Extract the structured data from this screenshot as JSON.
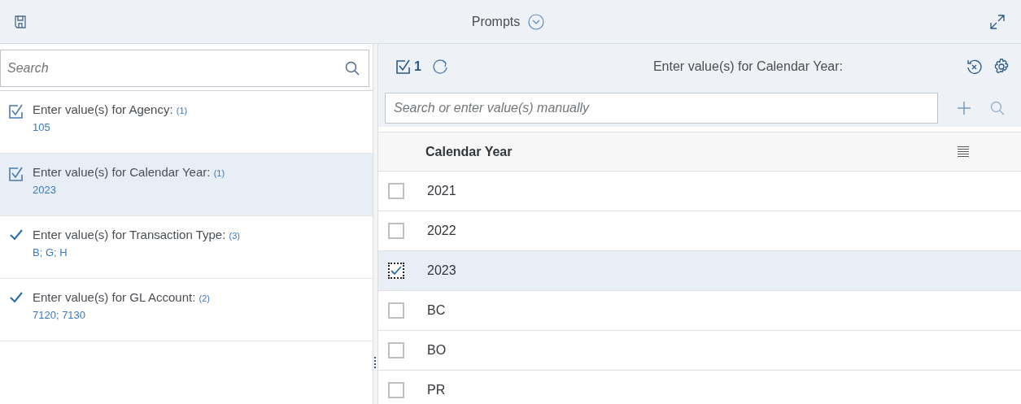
{
  "header": {
    "title": "Prompts"
  },
  "sidebar": {
    "search": {
      "placeholder": "Search"
    },
    "items": [
      {
        "kind": "box-check",
        "label": "Enter value(s) for Agency:",
        "count": "(1)",
        "values": "105",
        "selected": false
      },
      {
        "kind": "box-check",
        "label": "Enter value(s) for Calendar Year:",
        "count": "(1)",
        "values": "2023",
        "selected": true
      },
      {
        "kind": "check",
        "label": "Enter value(s) for Transaction Type:",
        "count": "(3)",
        "values": "B; G; H",
        "selected": false
      },
      {
        "kind": "check",
        "label": "Enter value(s) for GL Account:",
        "count": "(2)",
        "values": "7120; 7130",
        "selected": false
      }
    ]
  },
  "panel": {
    "selected_count": "1",
    "title": "Enter value(s) for Calendar Year:",
    "search": {
      "placeholder": "Search or enter value(s) manually"
    },
    "table": {
      "columns": [
        "Calendar Year"
      ],
      "rows": [
        {
          "value": "2021",
          "checked": false
        },
        {
          "value": "2022",
          "checked": false
        },
        {
          "value": "2023",
          "checked": true
        },
        {
          "value": "BC",
          "checked": false
        },
        {
          "value": "BO",
          "checked": false
        },
        {
          "value": "PR",
          "checked": false
        }
      ]
    }
  }
}
